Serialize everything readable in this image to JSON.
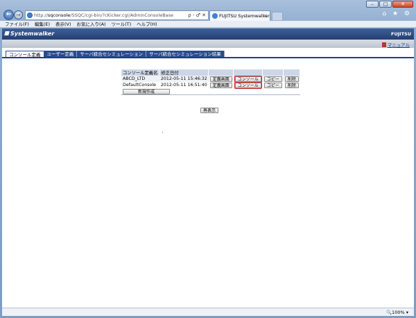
{
  "browser": {
    "address_prefix": "http://",
    "address_domain": "sqconsole",
    "address_path": "/SSQC/cgi-bin/?cKicker.cgi/AdminConsoleBase",
    "address_tools": "ρ - ♂ ✕",
    "tab_title": "FUJITSU Systemwalker...",
    "tab_close": "×",
    "right_icons": "⌂ ★ ⚙",
    "window_controls": [
      "–",
      "□",
      "✕"
    ],
    "menu": [
      "ファイル(F)",
      "編集(E)",
      "表示(V)",
      "お気に入り(A)",
      "ツール(T)",
      "ヘルプ(H)"
    ]
  },
  "app": {
    "brand": "Systemwalker",
    "vendor": "FUJITSU",
    "manual_link": "マニュアル",
    "tabs": [
      {
        "label": "コンソール定義"
      },
      {
        "label": "ユーザー定義"
      },
      {
        "label": "サーバ統合セシミュレーション"
      },
      {
        "label": "サーバ統合セシミュレーション結果"
      }
    ]
  },
  "console_table": {
    "headers": [
      "コンソール定義名",
      "修正日付"
    ],
    "rows": [
      {
        "name": "ABCD_LTD",
        "date": "2012-05-11 15:46:32",
        "b1": "定義画面",
        "b2": "コンソール",
        "b3": "コピー",
        "b4": "削除"
      },
      {
        "name": "DefaultConsole",
        "date": "2012-05-11 16:51:40",
        "b1": "定義画面",
        "b2": "コンソール",
        "b3": "コピー",
        "b4": "削除"
      }
    ],
    "create_button": "新規作成",
    "refresh_button": "再表示"
  },
  "status": {
    "zoom": "🔍100%",
    "zoom_arrow": "▾"
  }
}
